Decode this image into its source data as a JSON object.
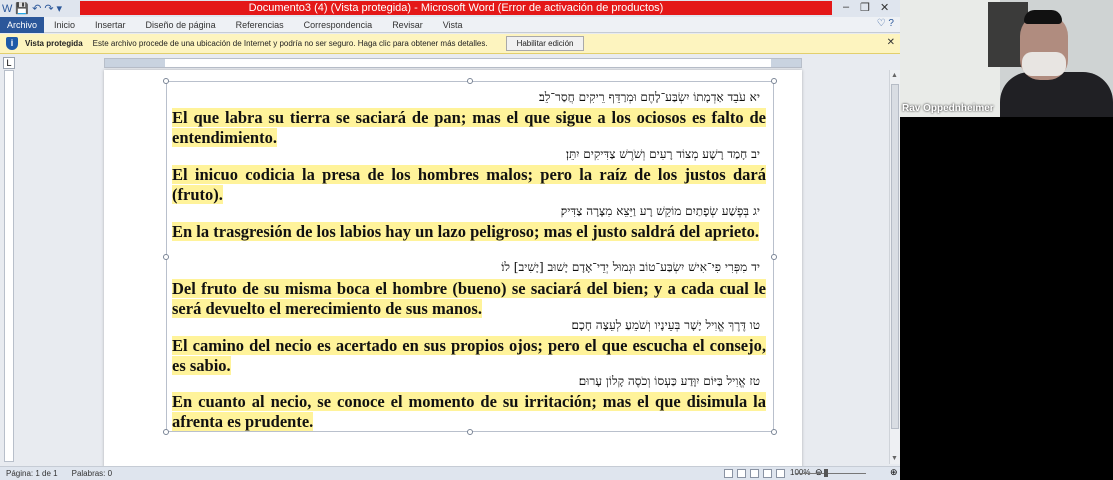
{
  "window": {
    "title": "Documento3 (4) (Vista protegida) - Microsoft Word (Error de activación de productos)",
    "controls": [
      "–",
      "❐",
      "✕"
    ]
  },
  "quick_access": [
    "W",
    "💾",
    "↶",
    "↷",
    "▾"
  ],
  "ribbon": {
    "tabs": [
      "Archivo",
      "Inicio",
      "Insertar",
      "Diseño de página",
      "Referencias",
      "Correspondencia",
      "Revisar",
      "Vista"
    ],
    "help": "♡ ?"
  },
  "message_bar": {
    "title": "Vista protegida",
    "text": "Este archivo procede de una ubicación de Internet y podría no ser seguro. Haga clic para obtener más detalles.",
    "button": "Habilitar edición",
    "close": "✕"
  },
  "verses": [
    {
      "hebrew": "יא עֹבֵד אַדְמָתוֹ יִשְׂבַּע־לָחֶם וּמְרַדֵּף רֵיקִים חֲסַר־לֵב׃",
      "spanish": "El que labra su tierra se saciará de pan; mas el que sigue a los ociosos es falto de entendimiento."
    },
    {
      "hebrew": "יב חָמַד רָשָׁע מְצוֹד רָעִים וְשֹׁרֶשׁ צַדִּיקִים יִתֵּן׃",
      "spanish": "El inicuo codicia la presa de los hombres malos; pero la raíz de los justos dará (fruto)."
    },
    {
      "hebrew": "יג בְּפֶשַׁע שְׂפָתַיִם מוֹקֵשׁ רָע וַיֵּצֵא מִצָּרָה צַדִּיק׃",
      "spanish": "En la trasgresión de los labios hay un lazo peligroso; mas el justo saldrá del aprieto."
    },
    {
      "hebrew": "יד מִפְּרִי פִי־אִישׁ יִשְׂבַּע־טוֹב וּגְמוּל יְדֵי־אָדָם יָשׁוּב [יָשִׁיב] לוֹ׃",
      "spanish": "Del fruto de su misma boca el hombre (bueno) se saciará del bien; y a cada cual le será devuelto el merecimiento de sus manos."
    },
    {
      "hebrew": "טו דֶּרֶךְ אֱוִיל יָשָׁר בְּעֵינָיו וְשֹׁמֵעַ לְעֵצָה חָכָם׃",
      "spanish": "El camino del necio es acertado en sus propios ojos; pero el que escucha el consejo, es sabio."
    },
    {
      "hebrew": "טז אֱוִיל בַּיּוֹם יִוָּדַע כַּעְסוֹ וְכֹסֶה קָלוֹן עָרוּם׃",
      "spanish": "En cuanto al necio, se conoce el momento de su irritación; mas el que disimula la afrenta es prudente."
    }
  ],
  "status": {
    "page": "Página: 1 de 1",
    "words": "Palabras: 0",
    "zoom": "100%"
  },
  "video": {
    "name": "Rav Oppednheimer"
  }
}
